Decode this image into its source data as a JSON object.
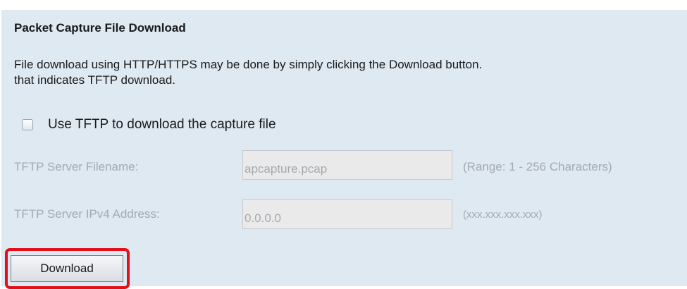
{
  "section": {
    "title": "Packet Capture File Download",
    "description_line1": "File download using HTTP/HTTPS may be done by simply clicking the Download button.",
    "description_line2": "that indicates TFTP download."
  },
  "tftp_option": {
    "label": "Use TFTP to download the capture file",
    "checked": false
  },
  "fields": {
    "filename_label": "TFTP Server Filename:",
    "filename_value": "apcapture.pcap",
    "filename_hint": "(Range: 1 - 256 Characters)",
    "ipv4_label": "TFTP Server IPv4 Address:",
    "ipv4_value": "0.0.0.0",
    "ipv4_hint": "(xxx.xxx.xxx.xxx)"
  },
  "actions": {
    "download_label": "Download"
  },
  "colors": {
    "panel_bg": "#dfe9f2",
    "disabled_text": "#a3a9b0",
    "highlight": "#e2101b"
  }
}
